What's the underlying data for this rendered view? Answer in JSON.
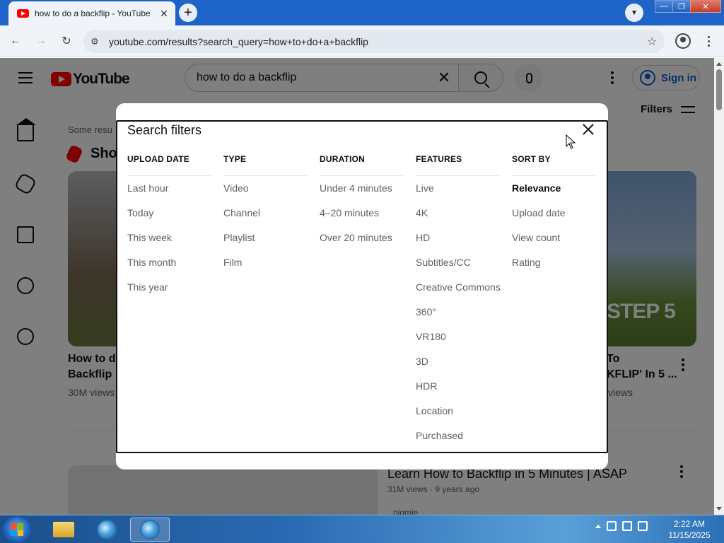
{
  "browser": {
    "tab_title": "how to do a backflip - YouTube",
    "tab_close": "✕",
    "new_tab": "+",
    "tab_menu": "▼",
    "url": "youtube.com/results?search_query=how+to+do+a+backflip",
    "back": "←",
    "forward": "→",
    "reload": "↻",
    "site_info": "⚙",
    "bookmark": "☆",
    "win_min": "—",
    "win_max": "❐",
    "win_close": "✕"
  },
  "youtube": {
    "logo_text": "YouTube",
    "search_query": "how to do a backflip",
    "clear": "✕",
    "sign_in": "Sign in",
    "filters": "Filters",
    "results_note": "Some resu",
    "shorts_label": "Sho",
    "videos": [
      {
        "title_line1": "How to do",
        "title_line2": "Backflip",
        "meta": "30M views"
      },
      {
        "title_line1": "To",
        "title_line2": "KFLIP' In 5 ...",
        "meta": "views"
      },
      {
        "title": "Learn How to Backflip in 5 Minutes | ASAP",
        "meta": "31M views · 9 years ago"
      }
    ],
    "thumb_overlay": "STEP 5",
    "bullet_text": "nigmie"
  },
  "dialog": {
    "title": "Search filters",
    "columns": [
      {
        "header": "UPLOAD DATE",
        "options": [
          "Last hour",
          "Today",
          "This week",
          "This month",
          "This year"
        ]
      },
      {
        "header": "TYPE",
        "options": [
          "Video",
          "Channel",
          "Playlist",
          "Film"
        ]
      },
      {
        "header": "DURATION",
        "options": [
          "Under 4 minutes",
          "4–20 minutes",
          "Over 20 minutes"
        ]
      },
      {
        "header": "FEATURES",
        "options": [
          "Live",
          "4K",
          "HD",
          "Subtitles/CC",
          "Creative Commons",
          "360°",
          "VR180",
          "3D",
          "HDR",
          "Location",
          "Purchased"
        ]
      },
      {
        "header": "SORT BY",
        "options": [
          "Relevance",
          "Upload date",
          "View count",
          "Rating"
        ]
      }
    ],
    "selected_sort": "Relevance"
  },
  "taskbar": {
    "time": "2:22 AM",
    "date": "11/15/2025"
  },
  "colors": {
    "youtube_red": "#ff0000",
    "link_blue": "#065fd4",
    "taskbar_blue": "#2a6ab4"
  }
}
